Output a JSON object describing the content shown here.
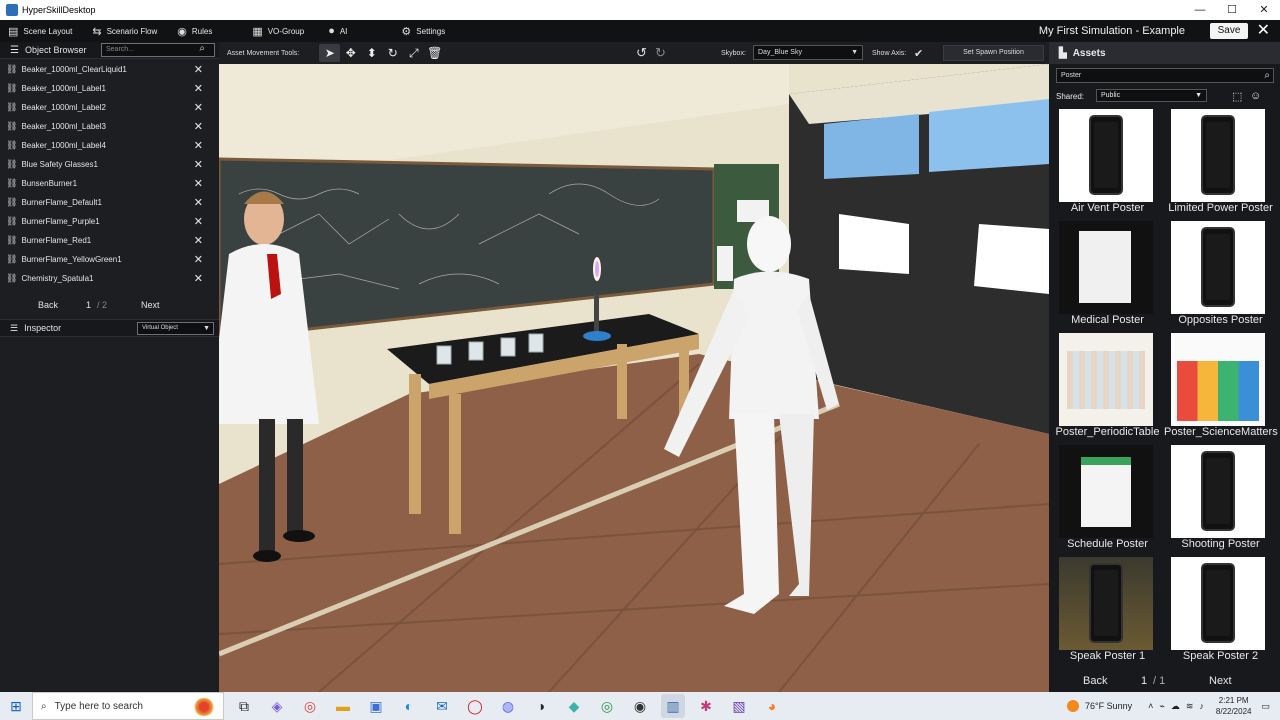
{
  "window": {
    "title": "HyperSkillDesktop",
    "controls": [
      "—",
      "☐",
      "✕"
    ]
  },
  "menu": {
    "items": [
      {
        "label": "Scene Layout",
        "icon": "layers-icon",
        "glyph": "▤"
      },
      {
        "label": "Scenario Flow",
        "icon": "flow-icon",
        "glyph": "⇆"
      },
      {
        "label": "Rules",
        "icon": "rules-icon",
        "glyph": "◉"
      },
      {
        "label": "VO-Group",
        "icon": "vo-group-icon",
        "glyph": "▦"
      },
      {
        "label": "AI",
        "icon": "person-icon",
        "glyph": "●"
      },
      {
        "label": "Settings",
        "icon": "gear-icon",
        "glyph": "⚙"
      }
    ],
    "sim_title": "My First Simulation - Example",
    "save_label": "Save",
    "close_glyph": "✕"
  },
  "object_browser": {
    "title": "Object Browser",
    "search_placeholder": "Search...",
    "items": [
      "Beaker_1000ml_ClearLiquid1",
      "Beaker_1000ml_Label1",
      "Beaker_1000ml_Label2",
      "Beaker_1000ml_Label3",
      "Beaker_1000ml_Label4",
      "Blue Safety Glasses1",
      "BunsenBurner1",
      "BurnerFlame_Default1",
      "BurnerFlame_Purple1",
      "BurnerFlame_Red1",
      "BurnerFlame_YellowGreen1",
      "Chemistry_Spatula1"
    ],
    "back_label": "Back",
    "page": "1",
    "page_total": "/ 2",
    "next_label": "Next"
  },
  "inspector": {
    "title": "Inspector",
    "select_value": "Virtual Object"
  },
  "toolbar": {
    "asset_tools_label": "Asset Movement Tools:",
    "tools": [
      {
        "name": "select-tool-icon",
        "glyph": "➤"
      },
      {
        "name": "move-tool-icon",
        "glyph": "✥"
      },
      {
        "name": "vertical-move-icon",
        "glyph": "⬍"
      },
      {
        "name": "rotate-tool-icon",
        "glyph": "↻"
      },
      {
        "name": "scale-tool-icon",
        "glyph": "⤢"
      },
      {
        "name": "trash-icon",
        "glyph": "🗑"
      }
    ],
    "undo_glyph": "↺",
    "redo_glyph": "↻",
    "skybox_label": "Skybox:",
    "skybox_value": "Day_Blue Sky",
    "show_axis_label": "Show Axis:",
    "show_axis_check": "✔",
    "spawn_label": "Set Spawn Position"
  },
  "assets": {
    "title": "Assets",
    "search_value": "Poster",
    "shared_label": "Shared:",
    "shared_value": "Public",
    "items": [
      {
        "name": "Air Vent Poster",
        "thumb": "phone"
      },
      {
        "name": "Limited Power Poster",
        "thumb": "phone"
      },
      {
        "name": "Medical Poster",
        "thumb": "paper"
      },
      {
        "name": "Opposites Poster",
        "thumb": "phone"
      },
      {
        "name": "Poster_PeriodicTable",
        "thumb": "table"
      },
      {
        "name": "Poster_ScienceMatters",
        "thumb": "science"
      },
      {
        "name": "Schedule Poster",
        "thumb": "schedule"
      },
      {
        "name": "Shooting Poster",
        "thumb": "phone"
      },
      {
        "name": "Speak Poster 1",
        "thumb": "phone-dark"
      },
      {
        "name": "Speak Poster 2",
        "thumb": "phone"
      }
    ],
    "back_label": "Back",
    "page": "1",
    "page_total": "/ 1",
    "next_label": "Next"
  },
  "taskbar": {
    "search_placeholder": "Type here to search",
    "weather": "76°F  Sunny",
    "time": "2:21 PM",
    "date": "8/22/2024",
    "apps": [
      {
        "name": "task-view-icon",
        "glyph": "⧉"
      },
      {
        "name": "copilot-icon",
        "glyph": "◈"
      },
      {
        "name": "chrome-icon",
        "glyph": "◎"
      },
      {
        "name": "file-explorer-icon",
        "glyph": "▬"
      },
      {
        "name": "store-icon",
        "glyph": "▣"
      },
      {
        "name": "edge-icon",
        "glyph": "◐"
      },
      {
        "name": "mail-icon",
        "glyph": "✉"
      },
      {
        "name": "opera-icon",
        "glyph": "◯"
      },
      {
        "name": "discord-icon",
        "glyph": "◍"
      },
      {
        "name": "steam-icon",
        "glyph": "◑"
      },
      {
        "name": "app-icon",
        "glyph": "◆"
      },
      {
        "name": "chrome-profile-icon",
        "glyph": "◎"
      },
      {
        "name": "obs-icon",
        "glyph": "◉"
      },
      {
        "name": "hyperskill-icon",
        "glyph": "▥"
      },
      {
        "name": "slack-icon",
        "glyph": "✱"
      },
      {
        "name": "clapper-icon",
        "glyph": "▧"
      },
      {
        "name": "firefox-icon",
        "glyph": "◕"
      }
    ]
  }
}
